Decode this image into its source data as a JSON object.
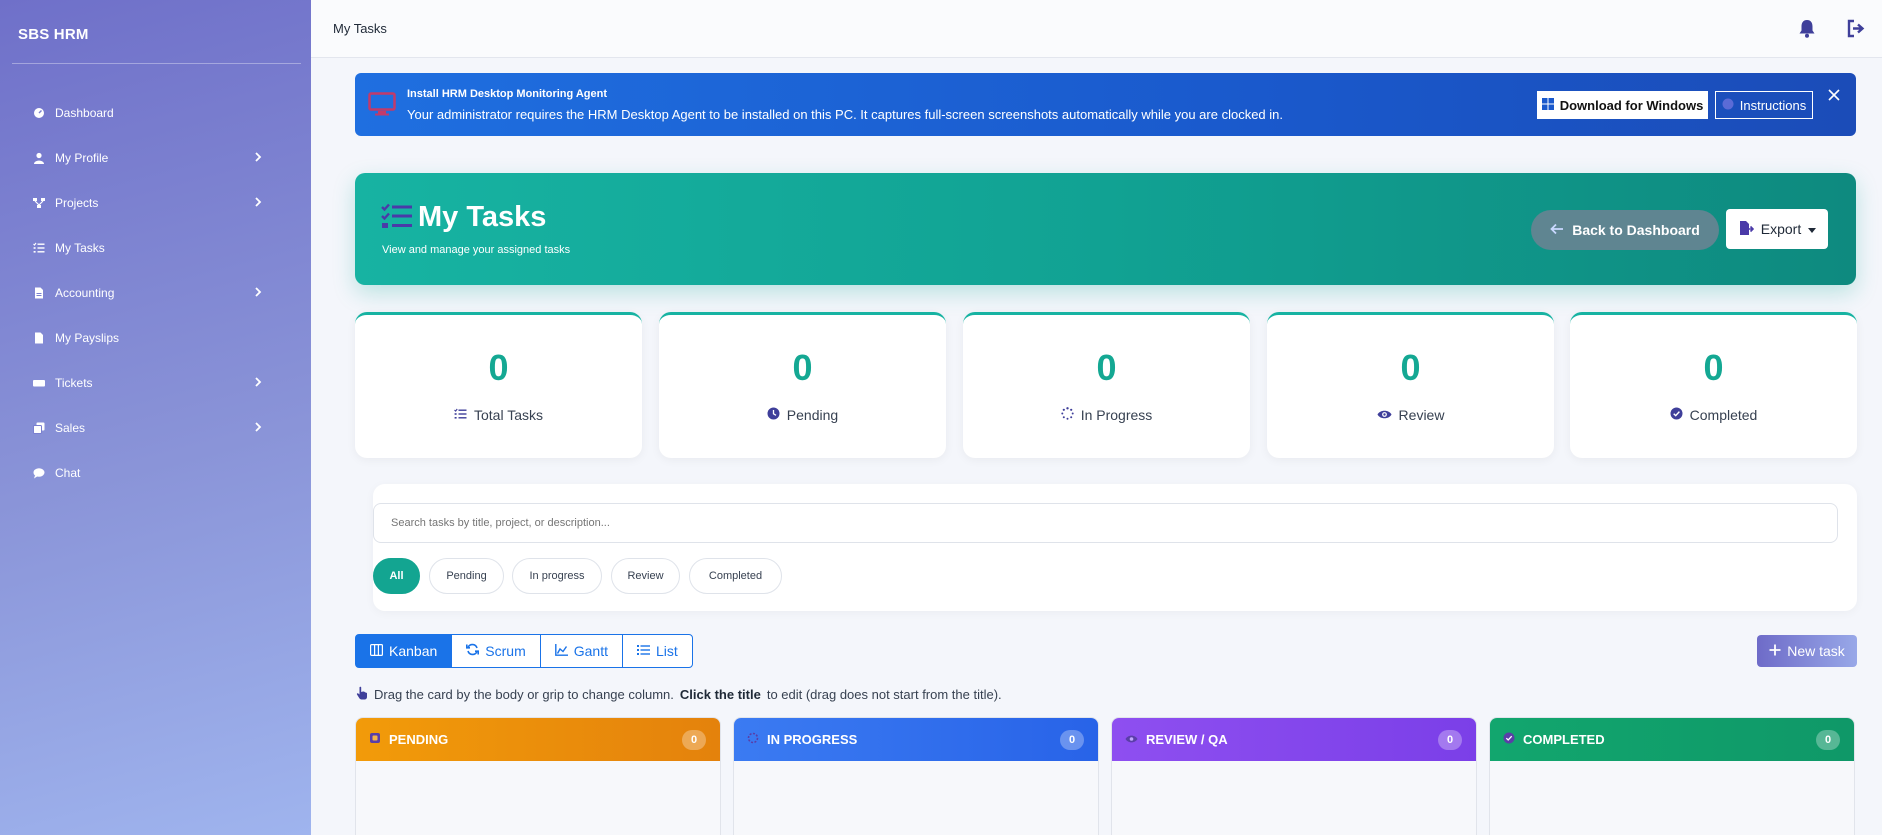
{
  "app": {
    "brand": "SBS HRM",
    "page_title": "My Tasks"
  },
  "sidebar": {
    "items": [
      {
        "label": "Dashboard",
        "icon": "gauge-icon",
        "has_children": false
      },
      {
        "label": "My Profile",
        "icon": "user-icon",
        "has_children": true
      },
      {
        "label": "Projects",
        "icon": "project-diagram-icon",
        "has_children": true
      },
      {
        "label": "My Tasks",
        "icon": "tasks-list-icon",
        "has_children": false
      },
      {
        "label": "Accounting",
        "icon": "file-invoice-icon",
        "has_children": true
      },
      {
        "label": "My Payslips",
        "icon": "file-icon",
        "has_children": false
      },
      {
        "label": "Tickets",
        "icon": "ticket-icon",
        "has_children": true
      },
      {
        "label": "Sales",
        "icon": "clone-icon",
        "has_children": true
      },
      {
        "label": "Chat",
        "icon": "chat-bubble-icon",
        "has_children": false
      }
    ]
  },
  "agent_banner": {
    "title": "Install HRM Desktop Monitoring Agent",
    "text": "Your administrator requires the HRM Desktop Agent to be installed on this PC. It captures full-screen screenshots automatically while you are clocked in.",
    "download_label": "Download for Windows",
    "instructions_label": "Instructions"
  },
  "hero": {
    "title": "My Tasks",
    "subtitle": "View and manage your assigned tasks",
    "back_label": "Back to Dashboard",
    "export_label": "Export"
  },
  "stats": [
    {
      "value": "0",
      "label": "Total Tasks",
      "icon": "tasks-list-icon"
    },
    {
      "value": "0",
      "label": "Pending",
      "icon": "clock-icon"
    },
    {
      "value": "0",
      "label": "In Progress",
      "icon": "spinner-icon"
    },
    {
      "value": "0",
      "label": "Review",
      "icon": "eye-icon"
    },
    {
      "value": "0",
      "label": "Completed",
      "icon": "check-circle-icon"
    }
  ],
  "search": {
    "placeholder": "Search tasks by title, project, or description..."
  },
  "filter_chips": [
    "All",
    "Pending",
    "In progress",
    "Review",
    "Completed"
  ],
  "views": {
    "tabs": [
      "Kanban",
      "Scrum",
      "Gantt",
      "List"
    ],
    "active": "Kanban",
    "new_task_label": "New task"
  },
  "hint": {
    "part1": "Drag the card by the body or grip to change column.",
    "bold": "Click the title",
    "part2": "to edit (drag does not start from the title)."
  },
  "columns": [
    {
      "title": "PENDING",
      "count": "0",
      "color": "#f29b0a"
    },
    {
      "title": "IN PROGRESS",
      "count": "0",
      "color": "#2f6ff0"
    },
    {
      "title": "REVIEW / QA",
      "count": "0",
      "color": "#8b4ef0"
    },
    {
      "title": "COMPLETED",
      "count": "0",
      "color": "#12a66e"
    }
  ],
  "colors": {
    "teal": "#14a893",
    "blue": "#1a73e8",
    "sidebar_start": "#6f70c9",
    "sidebar_end": "#9fb4ee"
  }
}
